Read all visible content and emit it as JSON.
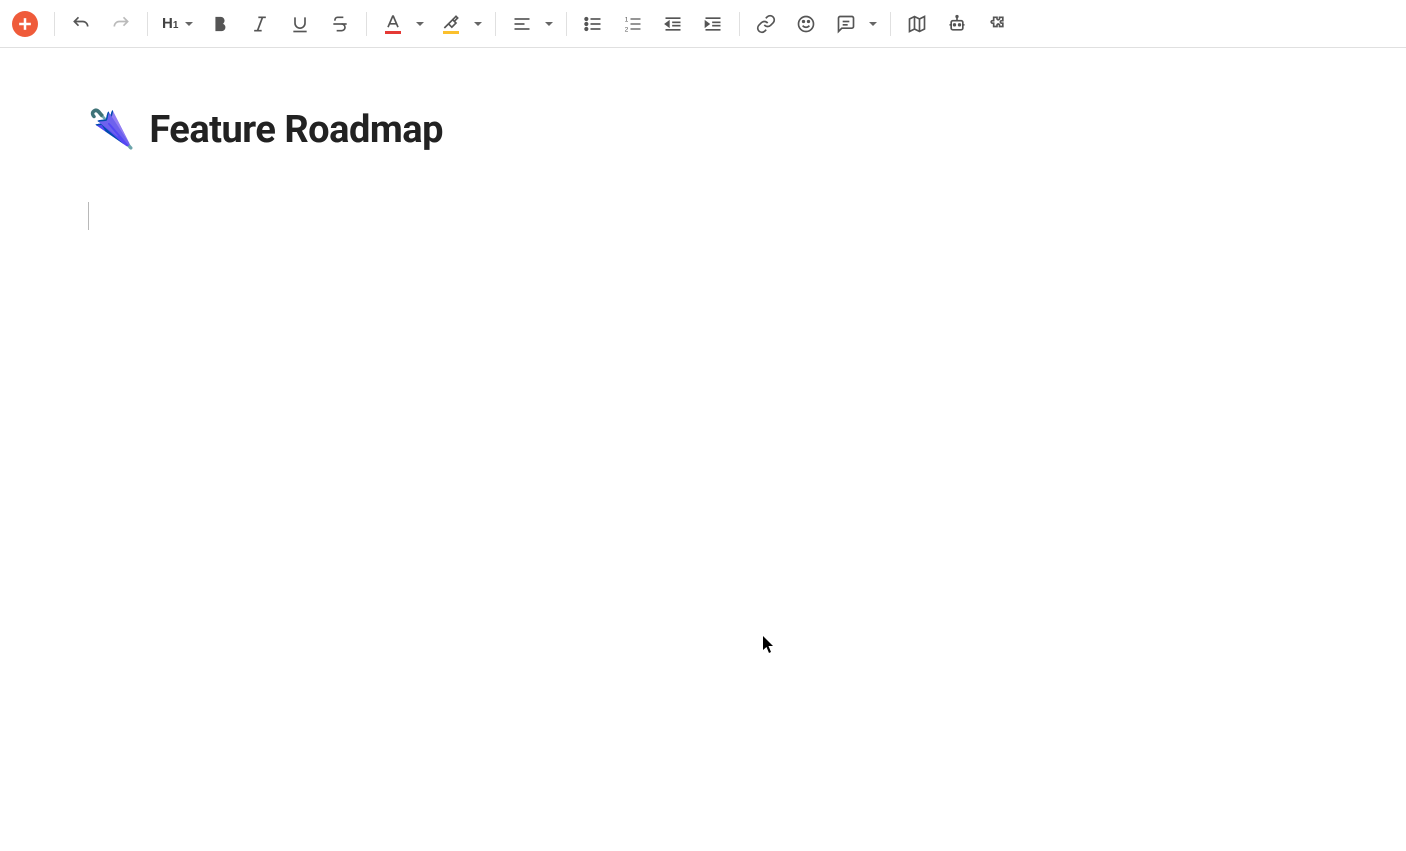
{
  "toolbar": {
    "heading_label": "H",
    "heading_level": "1"
  },
  "document": {
    "icon_emoji": "🌂",
    "title": "Feature Roadmap"
  },
  "colors": {
    "font_color": "#e53935",
    "highlight_color": "#fbc02d",
    "add_button": "#ef5b3a"
  }
}
